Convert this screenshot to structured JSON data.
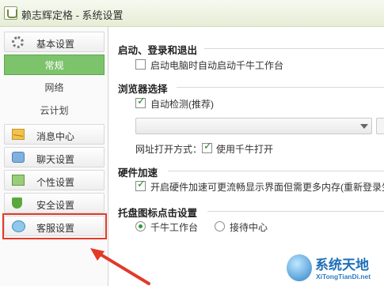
{
  "window": {
    "title": "赖志辉定格 - 系统设置"
  },
  "sidebar": {
    "items": [
      {
        "label": "基本设置",
        "icon": "gear-icon"
      },
      {
        "label": "常规",
        "active": true
      },
      {
        "label": "网络"
      },
      {
        "label": "云计划"
      },
      {
        "label": "消息中心",
        "icon": "mail-icon"
      },
      {
        "label": "聊天设置",
        "icon": "chat-icon"
      },
      {
        "label": "个性设置",
        "icon": "personalize-icon"
      },
      {
        "label": "安全设置",
        "icon": "shield-icon"
      },
      {
        "label": "客服设置",
        "icon": "customer-service-icon"
      }
    ]
  },
  "content": {
    "startup": {
      "title": "启动、登录和退出",
      "autostart_label": "启动电脑时自动启动千牛工作台",
      "autostart_checked": false
    },
    "browser": {
      "title": "浏览器选择",
      "autodetect_label": "自动检测(推荐)",
      "autodetect_checked": true,
      "select_value": "",
      "open_mode_label": "网址打开方式：",
      "use_qianniu_label": "使用千牛打开",
      "use_qianniu_checked": true
    },
    "hardware": {
      "title": "硬件加速",
      "accel_label": "开启硬件加速可更流畅显示界面但需更多内存(重新登录生",
      "accel_checked": true
    },
    "tray": {
      "title": "托盘图标点击设置",
      "options": [
        {
          "label": "千牛工作台",
          "checked": true
        },
        {
          "label": "接待中心",
          "checked": false
        }
      ]
    }
  },
  "watermark": {
    "text_cn": "系统天地",
    "text_en": "XiTongTianDi.net"
  },
  "colors": {
    "accent": "#7cc36c",
    "annotation": "#e23a2a",
    "watermark": "#1e6fb7"
  }
}
